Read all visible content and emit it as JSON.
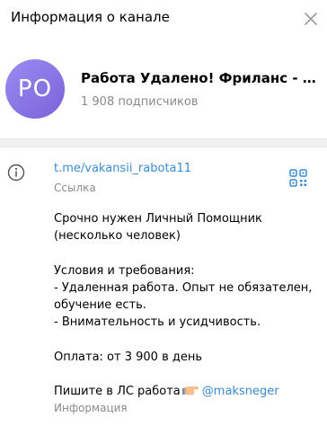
{
  "header": {
    "title": "Информация о канале"
  },
  "profile": {
    "initials": "PO",
    "name": "Работа Удалено! Фриланс - отзывы",
    "subscribers": "1 908 подписчиков"
  },
  "info": {
    "link": "t.me/vakansii_rabota11",
    "link_label": "Ссылка",
    "description_lines": [
      "Срочно нужен Личный Помощник",
      "(несколько человек)",
      "",
      "Условия и требования:",
      "- Удаленная работа. Опыт не обязателен,",
      "обучение есть.",
      "- Внимательность и усидчивость.",
      "",
      "Оплата: от 3 900 в день",
      ""
    ],
    "last_line_text": "Пишите в ЛС работа",
    "mention": "@maksneger",
    "description_label": "Информация"
  },
  "colors": {
    "accent": "#3a8bd1",
    "avatar": "#8b78e6",
    "muted": "#8a8a8a"
  },
  "icons": [
    "close-icon",
    "info-icon",
    "qr-code-icon",
    "pointing-hand-icon"
  ]
}
